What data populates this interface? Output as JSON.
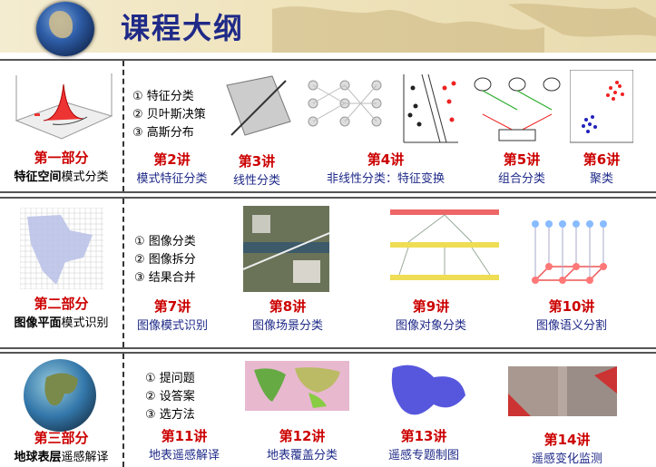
{
  "header": {
    "title": "课程大纲"
  },
  "parts": [
    {
      "name": "第一部分",
      "sub_bold": "特征空间",
      "sub_rest": "模式分类"
    },
    {
      "name": "第二部分",
      "sub_bold": "图像平面",
      "sub_rest": "模式识别"
    },
    {
      "name": "第三部分",
      "sub_bold": "地球表层",
      "sub_rest": "遥感解译"
    }
  ],
  "bullets": {
    "part1": [
      "① 特征分类",
      "② 贝叶斯决策",
      "③ 高斯分布"
    ],
    "part2": [
      "① 图像分类",
      "② 图像拆分",
      "③ 结果合并"
    ],
    "part3": [
      "① 提问题",
      "② 设答案",
      "③ 选方法"
    ]
  },
  "lectures": [
    {
      "num": "第2讲",
      "title": "模式特征分类"
    },
    {
      "num": "第3讲",
      "title": "线性分类"
    },
    {
      "num": "第4讲",
      "title": "非线性分类：特征变换"
    },
    {
      "num": "第5讲",
      "title": "组合分类"
    },
    {
      "num": "第6讲",
      "title": "聚类"
    },
    {
      "num": "第7讲",
      "title": "图像模式识别"
    },
    {
      "num": "第8讲",
      "title": "图像场景分类"
    },
    {
      "num": "第9讲",
      "title": "图像对象分类"
    },
    {
      "num": "第10讲",
      "title": "图像语义分割"
    },
    {
      "num": "第11讲",
      "title": "地表遥感解译"
    },
    {
      "num": "第12讲",
      "title": "地表覆盖分类"
    },
    {
      "num": "第13讲",
      "title": "遥感专题制图"
    },
    {
      "num": "第14讲",
      "title": "遥感变化监测"
    }
  ]
}
